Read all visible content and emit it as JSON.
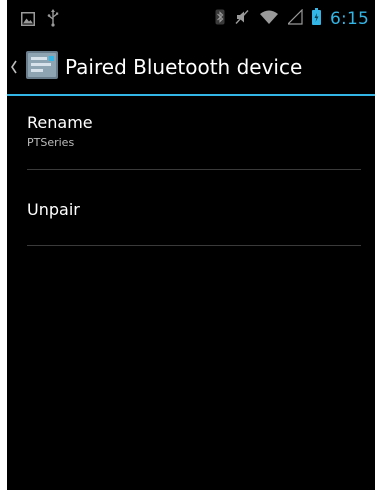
{
  "status_bar": {
    "time": "6:15",
    "accent_color": "#33b5e5",
    "left_icons": [
      "screenshot-icon",
      "usb-icon"
    ],
    "right_icons": [
      "bluetooth-icon",
      "mute-icon",
      "wifi-icon",
      "signal-icon",
      "battery-icon"
    ]
  },
  "action_bar": {
    "title": "Paired Bluetooth device",
    "icons": [
      "up-caret-icon",
      "app-settings-icon"
    ]
  },
  "preferences": [
    {
      "title": "Rename",
      "summary": "PTSeries"
    },
    {
      "title": "Unpair"
    }
  ]
}
